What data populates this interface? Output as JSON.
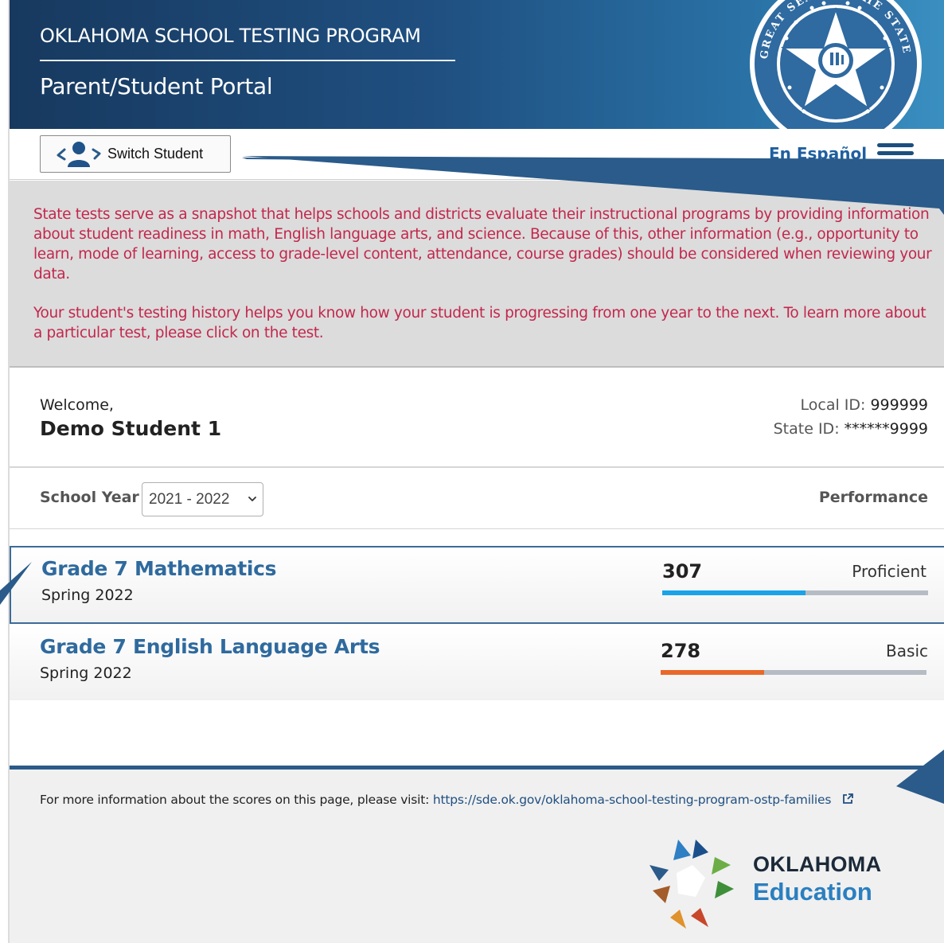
{
  "header": {
    "title": "OKLAHOMA SCHOOL TESTING PROGRAM",
    "subtitle": "Parent/Student Portal",
    "seal_text": "GREAT SEAL OF THE STATE OF OKLAHOMA"
  },
  "toolbar": {
    "switch_label": "Switch Student",
    "language_link": "En Español"
  },
  "notice": {
    "paragraph1": "State tests serve as a snapshot that helps schools and districts evaluate their instructional programs by providing information about student readiness in math, English language arts, and science. Because of this, other information (e.g., opportunity to learn, mode of learning, access to grade-level content, attendance, course grades) should be considered when reviewing your data.",
    "paragraph2": "Your student's testing history helps you know how your student is progressing from one year to the next. To learn more about a particular test, please click on the test."
  },
  "student": {
    "welcome": "Welcome,",
    "name": "Demo Student 1",
    "local_id_label": "Local ID:",
    "local_id": "999999",
    "state_id_label": "State ID:",
    "state_id": "******9999"
  },
  "filters": {
    "school_year_label": "School Year",
    "school_year_selected": "2021 - 2022",
    "performance_label": "Performance"
  },
  "tests": [
    {
      "name": "Grade 7 Mathematics",
      "term": "Spring 2022",
      "score": "307",
      "level": "Proficient",
      "progress": 0.54,
      "color": "#1aa3e8"
    },
    {
      "name": "Grade 7 English Language Arts",
      "term": "Spring 2022",
      "score": "278",
      "level": "Basic",
      "progress": 0.39,
      "color": "#e8692a"
    }
  ],
  "footer": {
    "info_text": "For more information about the scores on this page, please visit:",
    "link": "https://sde.ok.gov/oklahoma-school-testing-program-ostp-families",
    "logo_line1": "OKLAHOMA",
    "logo_line2": "Education"
  },
  "colors": {
    "header_dark": "#17395f",
    "header_light": "#3a8fc1",
    "link_blue": "#2f6a9e",
    "notice_red": "#c3274c",
    "notice_bg": "#dcdcdc"
  }
}
